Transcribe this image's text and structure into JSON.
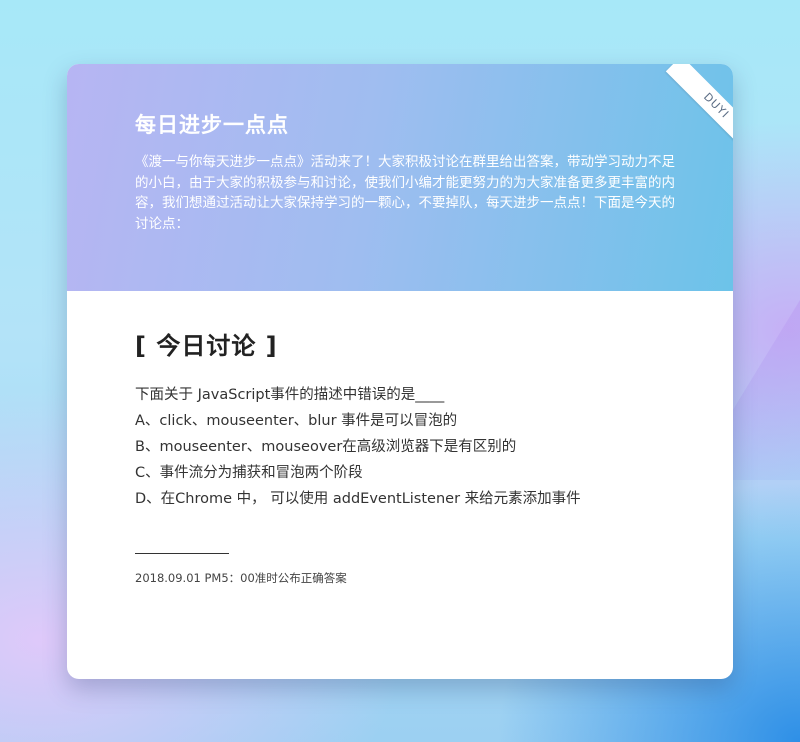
{
  "ribbon": {
    "label": "DUYI"
  },
  "header": {
    "title": "每日进步一点点",
    "intro": "《渡一与你每天进步一点点》活动来了！大家积极讨论在群里给出答案，带动学习动力不足的小白，由于大家的积极参与和讨论，使我们小编才能更努力的为大家准备更多更丰富的内容，我们想通过活动让大家保持学习的一颗心，不要掉队，每天进步一点点！下面是今天的讨论点："
  },
  "discussion": {
    "title": "[ 今日讨论 ]",
    "question": "下面关于 JavaScript事件的描述中错误的是____",
    "options": [
      "A、click、mouseenter、blur 事件是可以冒泡的",
      "B、mouseenter、mouseover在高级浏览器下是有区别的",
      "C、事件流分为捕获和冒泡两个阶段",
      "D、在Chrome 中， 可以使用 addEventListener 来给元素添加事件"
    ]
  },
  "footer": {
    "note": "2018.09.01  PM5：00准时公布正确答案"
  }
}
